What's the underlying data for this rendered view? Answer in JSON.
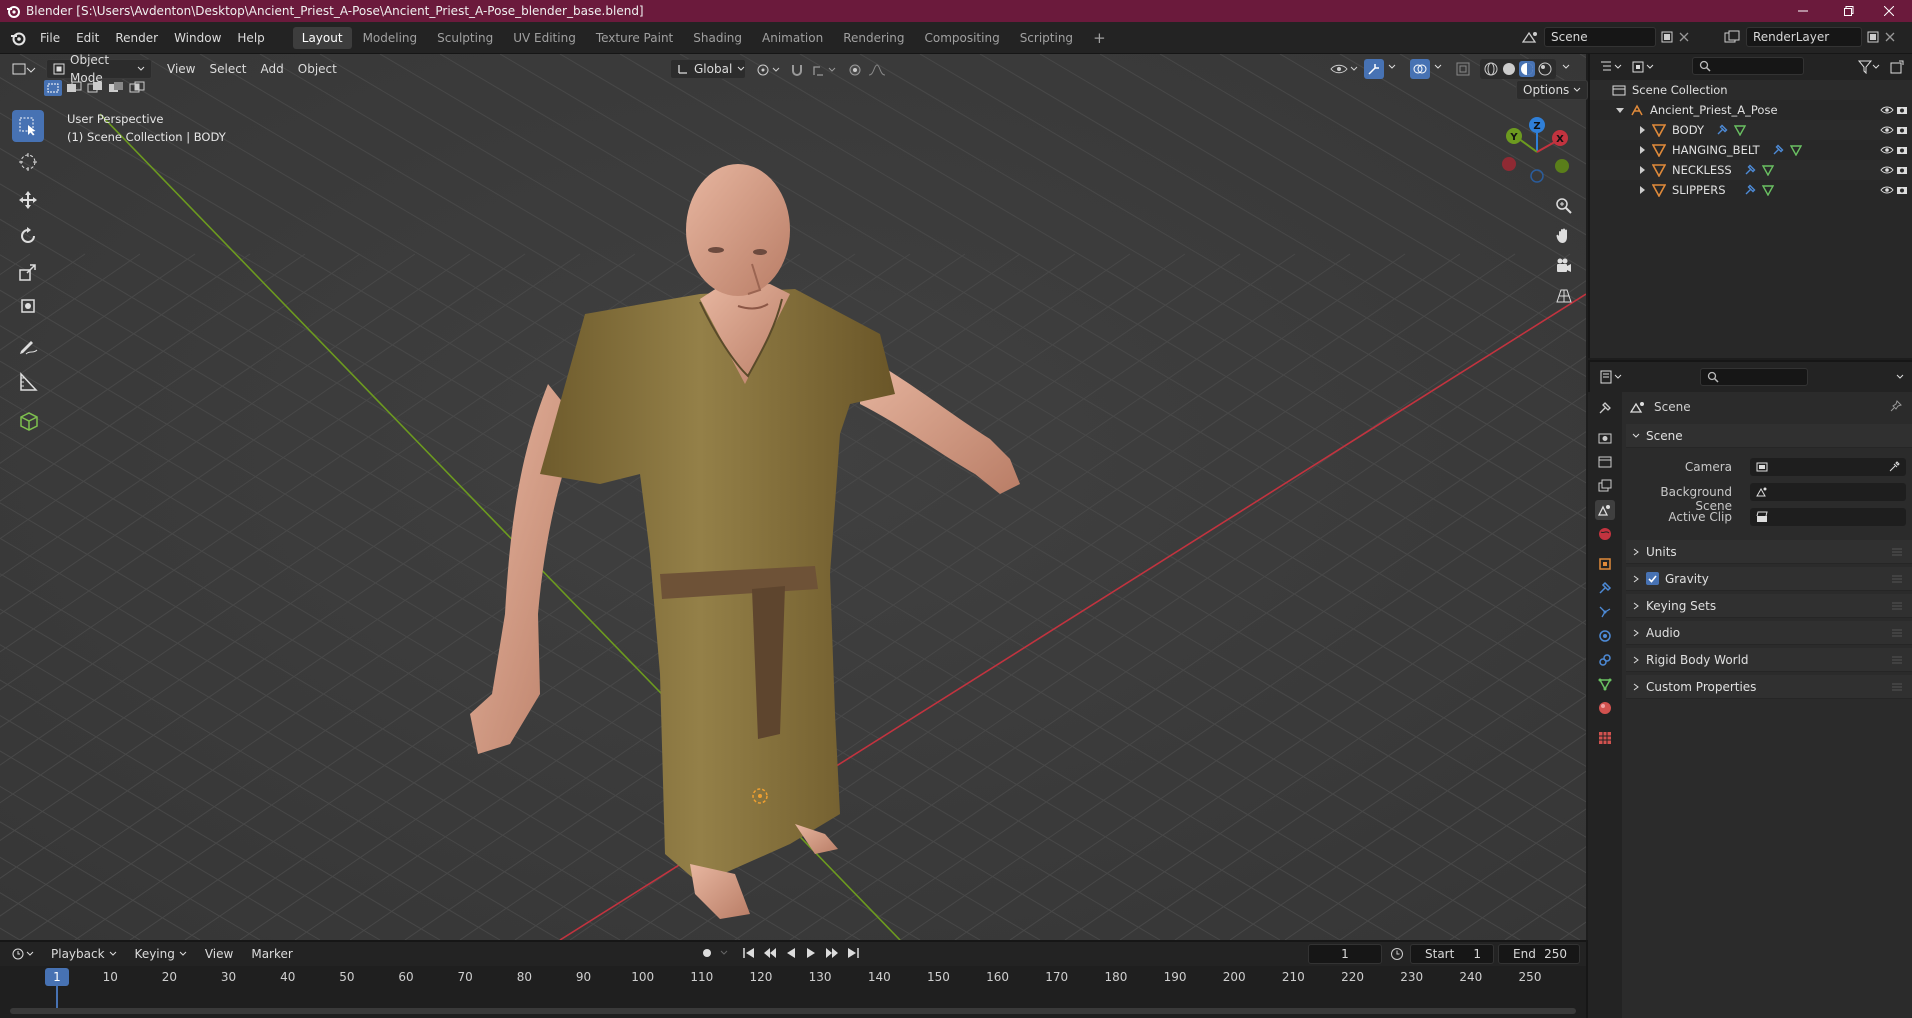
{
  "window": {
    "title": "Blender [S:\\Users\\Avdenton\\Desktop\\Ancient_Priest_A-Pose\\Ancient_Priest_A-Pose_blender_base.blend]"
  },
  "menu": [
    "File",
    "Edit",
    "Render",
    "Window",
    "Help"
  ],
  "workspaces": [
    "Layout",
    "Modeling",
    "Sculpting",
    "UV Editing",
    "Texture Paint",
    "Shading",
    "Animation",
    "Rendering",
    "Compositing",
    "Scripting"
  ],
  "active_workspace": "Layout",
  "top_right": {
    "scene": "Scene",
    "view_layer": "RenderLayer"
  },
  "viewport_header": {
    "mode": "Object Mode",
    "menus": [
      "View",
      "Select",
      "Add",
      "Object"
    ],
    "transform_orientation": "Global",
    "options_label": "Options"
  },
  "viewport_overlay": {
    "perspective": "User Perspective",
    "context": "(1) Scene Collection | BODY"
  },
  "gizmo": {
    "x": "X",
    "y": "Y",
    "z": "Z"
  },
  "outliner": {
    "root": "Scene Collection",
    "collection": "Ancient_Priest_A_Pose",
    "objects": [
      "BODY",
      "HANGING_BELT",
      "NECKLESS",
      "SLIPPERS"
    ]
  },
  "properties": {
    "context_title": "Scene",
    "panel_scene": "Scene",
    "fields": [
      {
        "label": "Camera"
      },
      {
        "label": "Background Scene"
      },
      {
        "label": "Active Clip"
      }
    ],
    "panels": [
      "Units",
      "Gravity",
      "Keying Sets",
      "Audio",
      "Rigid Body World",
      "Custom Properties"
    ],
    "gravity_enabled": true
  },
  "timeline": {
    "menus": [
      "Playback",
      "Keying",
      "View",
      "Marker"
    ],
    "current_frame": "1",
    "start_label": "Start",
    "start": "1",
    "end_label": "End",
    "end": "250",
    "ruler": [
      "1",
      "10",
      "20",
      "30",
      "40",
      "50",
      "60",
      "70",
      "80",
      "90",
      "100",
      "110",
      "120",
      "130",
      "140",
      "150",
      "160",
      "170",
      "180",
      "190",
      "200",
      "210",
      "220",
      "230",
      "240",
      "250"
    ]
  },
  "colors": {
    "titlebar": "#6b1a3c",
    "accent": "#4772b3",
    "x_axis": "#c2333f",
    "y_axis": "#6c9a1f",
    "z_axis": "#2f7fd8",
    "robe": "#8a7440"
  }
}
